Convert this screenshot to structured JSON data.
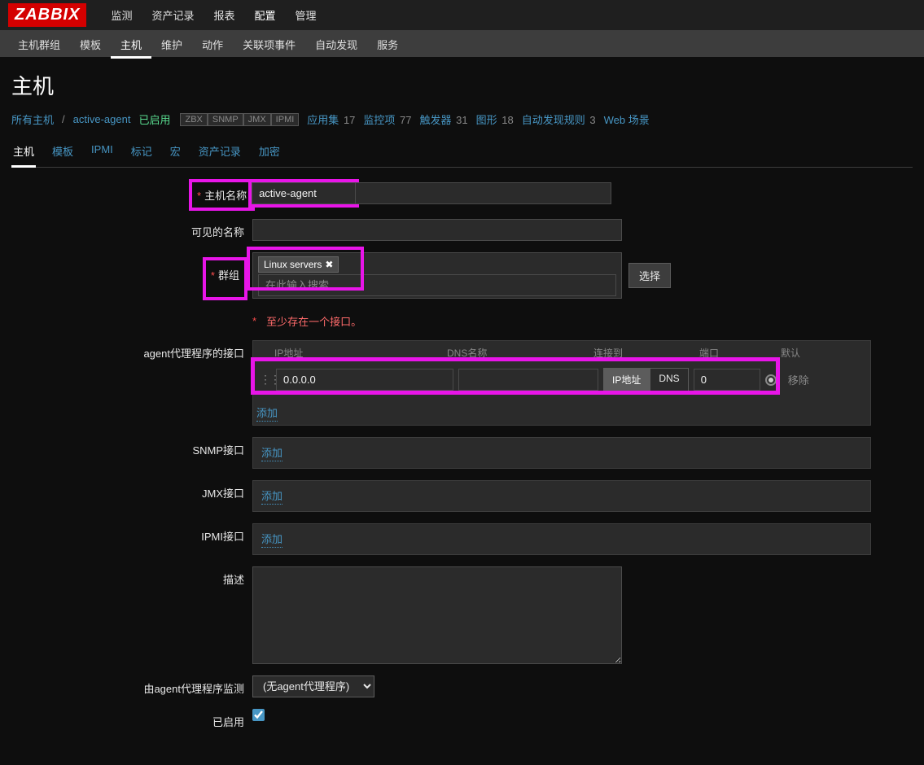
{
  "logo": "ZABBIX",
  "topnav": [
    "监测",
    "资产记录",
    "报表",
    "配置",
    "管理"
  ],
  "topnav_active": 3,
  "subnav": [
    "主机群组",
    "模板",
    "主机",
    "维护",
    "动作",
    "关联项事件",
    "自动发现",
    "服务"
  ],
  "subnav_active": 2,
  "page_title": "主机",
  "crumb": {
    "all_hosts": "所有主机",
    "host": "active-agent",
    "enabled": "已启用",
    "zbx": [
      "ZBX",
      "SNMP",
      "JMX",
      "IPMI"
    ],
    "links": [
      {
        "label": "应用集",
        "count": "17"
      },
      {
        "label": "监控项",
        "count": "77"
      },
      {
        "label": "触发器",
        "count": "31"
      },
      {
        "label": "图形",
        "count": "18"
      },
      {
        "label": "自动发现规则",
        "count": "3"
      },
      {
        "label": "Web 场景",
        "count": ""
      }
    ]
  },
  "tabs": [
    "主机",
    "模板",
    "IPMI",
    "标记",
    "宏",
    "资产记录",
    "加密"
  ],
  "tab_active": 0,
  "form": {
    "host_label": "主机名称",
    "host_value": "active-agent",
    "visible_label": "可见的名称",
    "visible_value": "",
    "group_label": "群组",
    "group_tag": "Linux servers",
    "group_search_ph": "在此输入搜索",
    "select_btn": "选择",
    "iface_error": "至少存在一个接口。",
    "agent_if_label": "agent代理程序的接口",
    "headers": {
      "ip": "IP地址",
      "dns": "DNS名称",
      "conn": "连接到",
      "port": "端口",
      "def": "默认"
    },
    "ip_value": "0.0.0.0",
    "dns_value": "",
    "conn_ip": "IP地址",
    "conn_dns": "DNS",
    "port_value": "0",
    "remove": "移除",
    "add": "添加",
    "snmp_label": "SNMP接口",
    "jmx_label": "JMX接口",
    "ipmi_label": "IPMI接口",
    "desc_label": "描述",
    "proxy_label": "由agent代理程序监测",
    "proxy_value": "(无agent代理程序)",
    "enabled_label": "已启用"
  }
}
